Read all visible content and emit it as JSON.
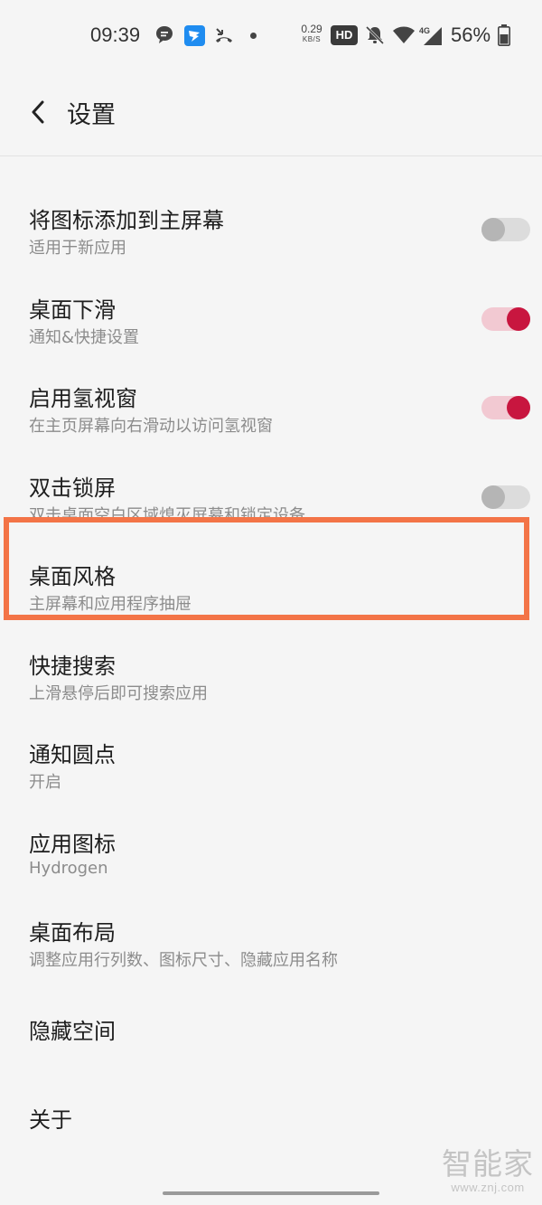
{
  "status_bar": {
    "time": "09:39",
    "net_speed_value": "0.29",
    "net_speed_unit": "KB/S",
    "hd_badge": "HD",
    "signal_tech": "4G",
    "battery_percent": "56%"
  },
  "header": {
    "title": "设置"
  },
  "settings": [
    {
      "title": "将图标添加到主屏幕",
      "subtitle": "适用于新应用",
      "toggle": "off"
    },
    {
      "title": "桌面下滑",
      "subtitle": "通知&快捷设置",
      "toggle": "on"
    },
    {
      "title": "启用氢视窗",
      "subtitle": "在主页屏幕向右滑动以访问氢视窗",
      "toggle": "on"
    },
    {
      "title": "双击锁屏",
      "subtitle": "双击桌面空白区域熄灭屏幕和锁定设备",
      "toggle": "off"
    },
    {
      "title": "桌面风格",
      "subtitle": "主屏幕和应用程序抽屉"
    },
    {
      "title": "快捷搜索",
      "subtitle": "上滑悬停后即可搜索应用"
    },
    {
      "title": "通知圆点",
      "subtitle": "开启"
    },
    {
      "title": "应用图标",
      "subtitle": "Hydrogen"
    },
    {
      "title": "桌面布局",
      "subtitle": "调整应用行列数、图标尺寸、隐藏应用名称"
    },
    {
      "title": "隐藏空间"
    },
    {
      "title": "关于"
    }
  ],
  "watermark": {
    "brand": "智能家",
    "url": "www.znj.com"
  },
  "colors": {
    "accent": "#c8163f",
    "highlight": "#f37447",
    "background": "#f5f5f5"
  }
}
